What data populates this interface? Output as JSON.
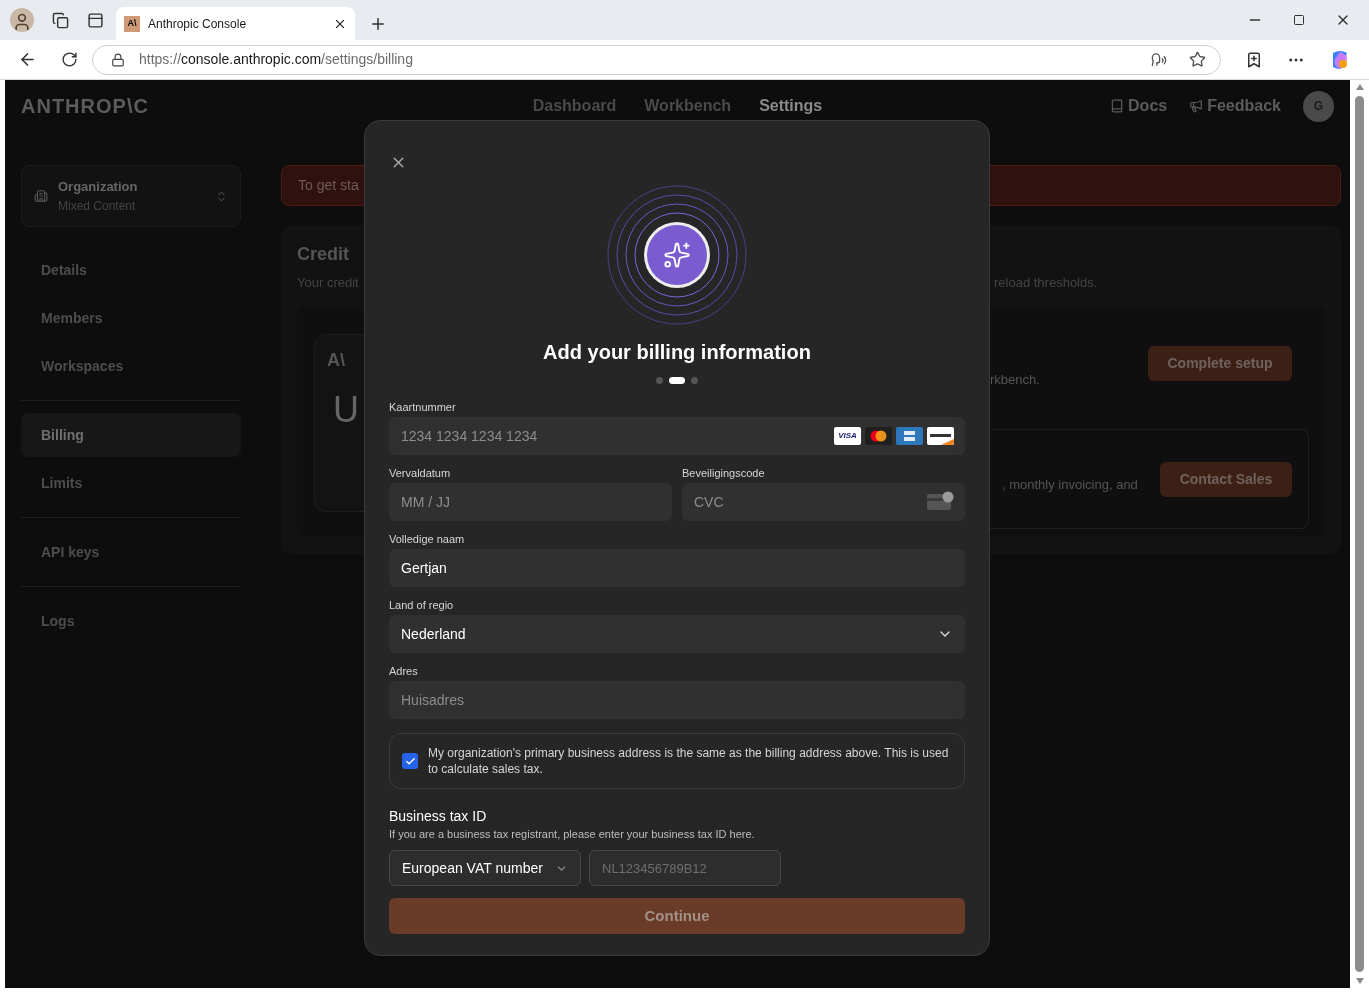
{
  "browser": {
    "tab_title": "Anthropic Console",
    "favicon": "A\\",
    "url_prefix": "https://",
    "url_host": "console.anthropic.com",
    "url_path": "/settings/billing"
  },
  "header": {
    "logo": "ANTHROP\\C",
    "nav": [
      {
        "label": "Dashboard",
        "selected": false
      },
      {
        "label": "Workbench",
        "selected": false
      },
      {
        "label": "Settings",
        "selected": true
      }
    ],
    "links": [
      {
        "label": "Docs",
        "kind": "docs"
      },
      {
        "label": "Feedback",
        "kind": "feedback"
      }
    ],
    "avatar": "G"
  },
  "sidebar": {
    "org": {
      "title": "Organization",
      "subtitle": "Mixed Content"
    },
    "groups": [
      [
        {
          "label": "Details",
          "selected": false
        },
        {
          "label": "Members",
          "selected": false
        },
        {
          "label": "Workspaces",
          "selected": false
        }
      ],
      [
        {
          "label": "Billing",
          "selected": true
        },
        {
          "label": "Limits",
          "selected": false
        }
      ],
      [
        {
          "label": "API keys",
          "selected": false
        }
      ],
      [
        {
          "label": "Logs",
          "selected": false
        }
      ]
    ]
  },
  "background": {
    "alert": "To get sta",
    "title": "Credit",
    "subtitle": "Your credit",
    "subtitle_tail": "reload thresholds.",
    "card_logo": "A\\",
    "card_letter": "U",
    "setup_text": "rkbench.",
    "setup_button": "Complete setup",
    "sales_text": ", monthly invoicing, and",
    "sales_button": "Contact Sales"
  },
  "modal": {
    "title": "Add your billing information",
    "steps": [
      {
        "selected": false
      },
      {
        "selected": true
      },
      {
        "selected": false
      }
    ],
    "fields": [
      {
        "kind": "card",
        "label": "Kaartnummer",
        "placeholder": "1234 1234 1234 1234",
        "brands": [
          {
            "kind": "visa",
            "label": "VISA"
          },
          {
            "kind": "mastercard"
          },
          {
            "kind": "amex"
          },
          {
            "kind": "discover"
          }
        ]
      },
      {
        "kind": "pair",
        "items": [
          {
            "label": "Vervaldatum",
            "placeholder": "MM / JJ"
          },
          {
            "label": "Beveiligingscode",
            "placeholder": "CVC",
            "kind": "cvc"
          }
        ]
      },
      {
        "kind": "text",
        "label": "Volledige naam",
        "value": "Gertjan"
      },
      {
        "kind": "select",
        "label": "Land of regio",
        "value": "Nederland"
      },
      {
        "kind": "text",
        "label": "Adres",
        "placeholder": "Huisadres"
      }
    ],
    "address_same": {
      "checked": true,
      "text": "My organization's primary business address is the same as the billing address above. This is used to calculate sales tax."
    },
    "tax": {
      "title": "Business tax ID",
      "help": "If you are a business tax registrant, please enter your business tax ID here.",
      "type": "European VAT number",
      "placeholder": "NL123456789B12"
    },
    "continue": "Continue"
  }
}
